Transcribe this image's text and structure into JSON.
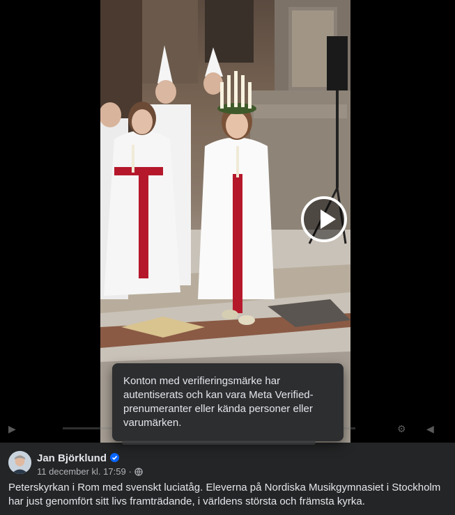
{
  "video": {
    "play_label": "Play"
  },
  "tooltip": {
    "text": "Konton med verifieringsmärke har autentiserats och kan vara Meta Verified-prenumeranter eller kända personer eller varumärken."
  },
  "post": {
    "author": "Jan Björklund",
    "date": "11 december kl. 17:59",
    "separator": "·",
    "caption": "Peterskyrkan i Rom med svenskt luciatåg. Eleverna på Nordiska Musikgymnasiet i Stockholm har just genomfört sitt livs framträdande, i världens största och främsta kyrka."
  },
  "colors": {
    "background": "#242526",
    "verified": "#0866ff",
    "text_primary": "#e4e6eb",
    "text_secondary": "#b0b3b8"
  },
  "icons": {
    "verified": "verified-badge-icon",
    "audience": "globe-icon",
    "play": "play-icon"
  }
}
